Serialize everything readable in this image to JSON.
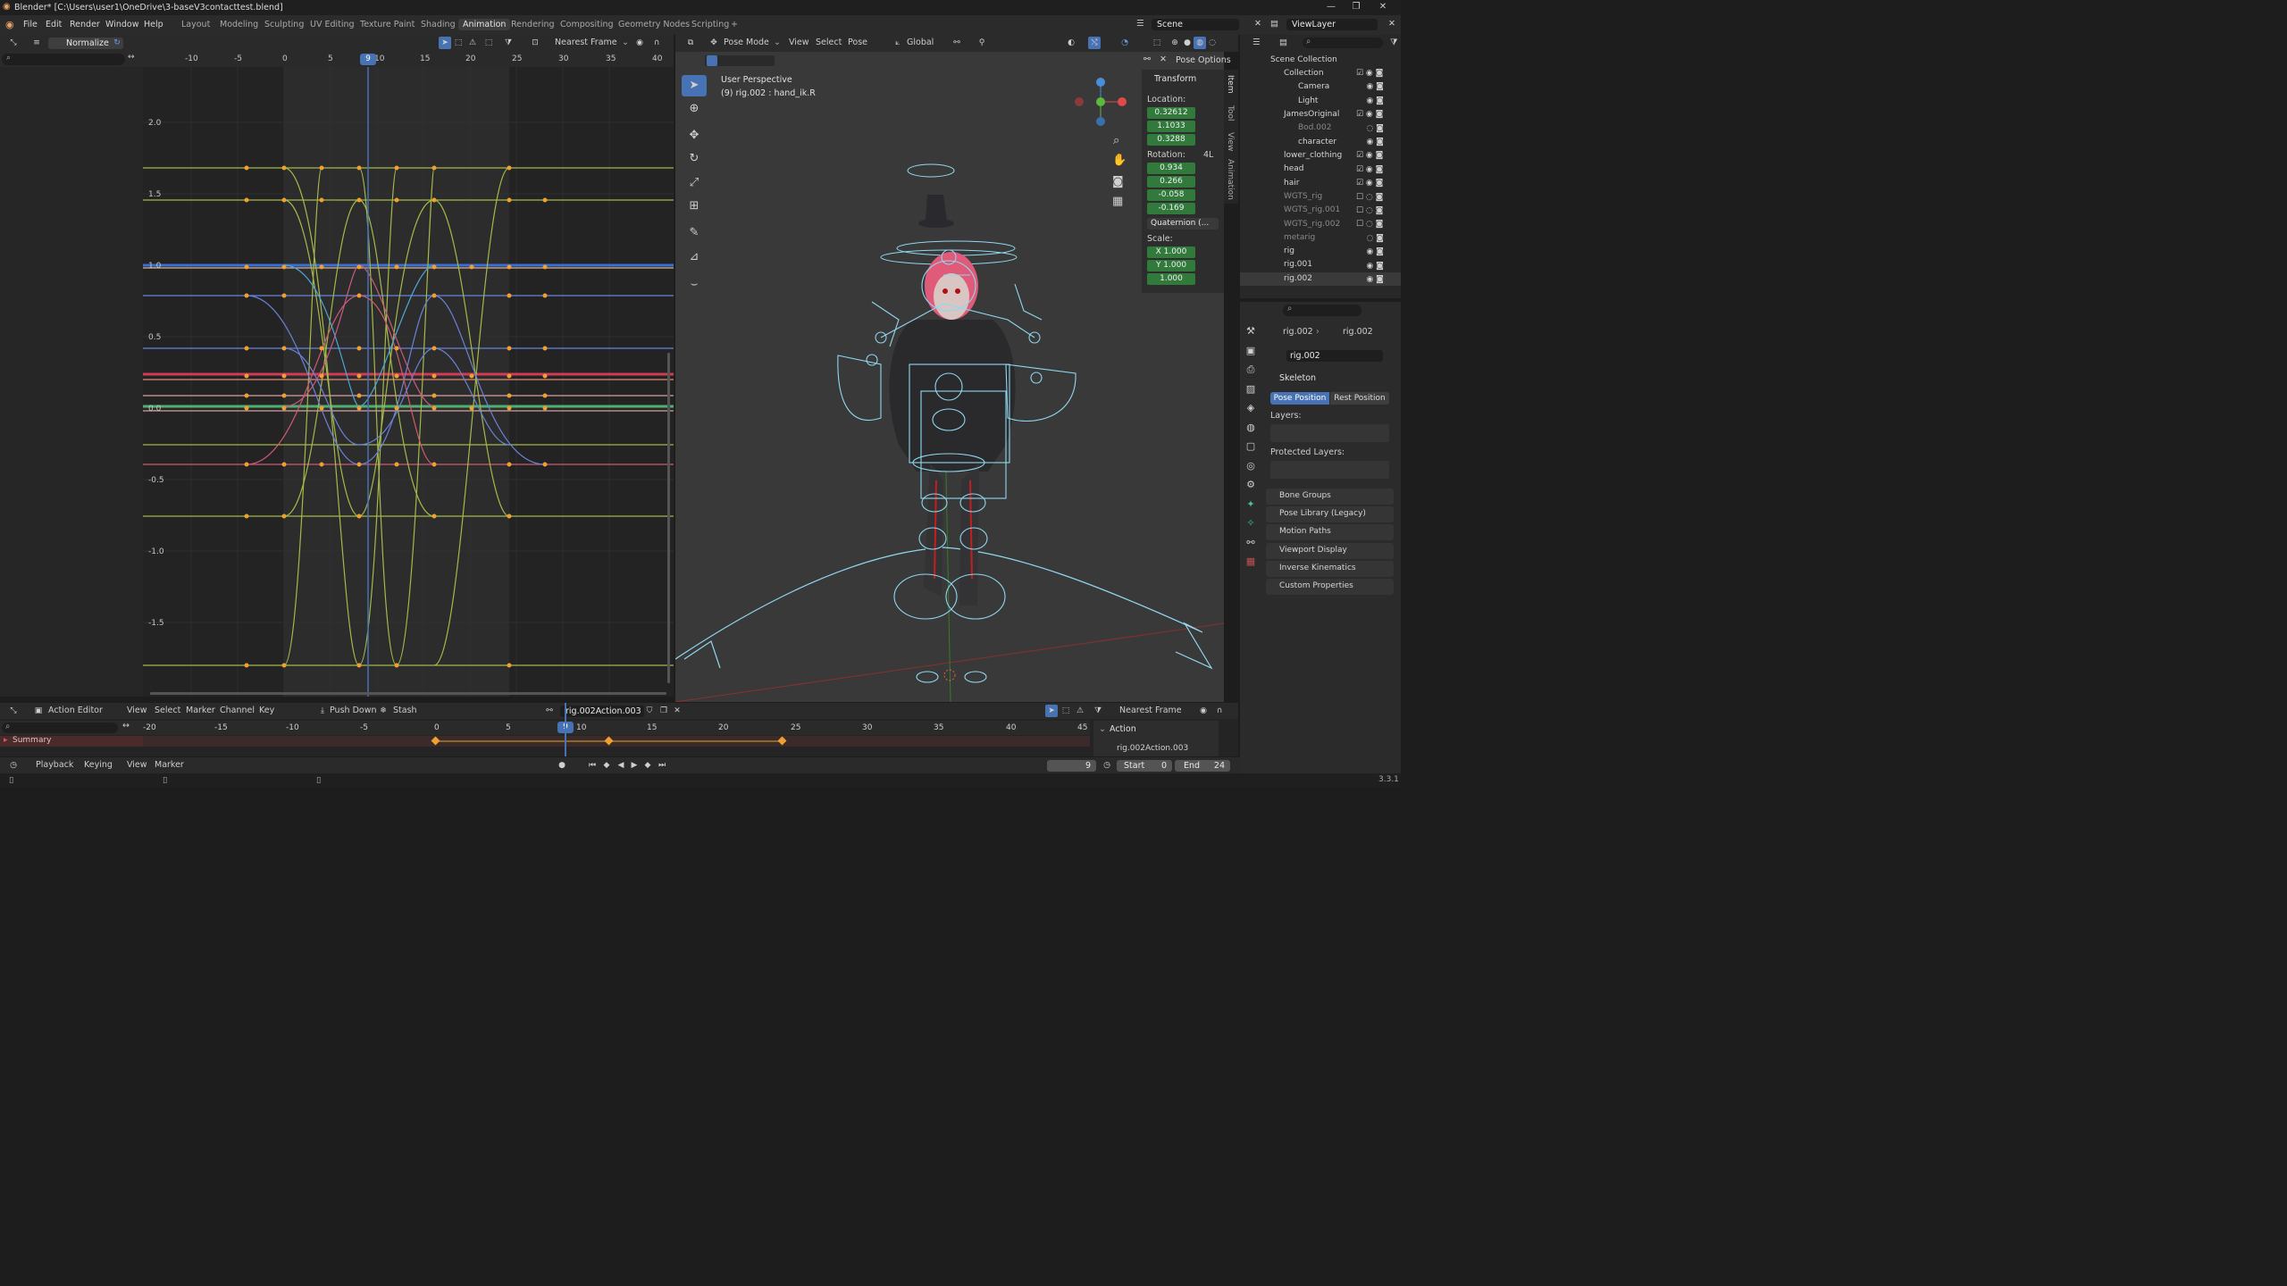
{
  "window": {
    "title": "Blender* [C:\\Users\\user1\\OneDrive\\3-baseV3contacttest.blend]"
  },
  "menu": [
    "File",
    "Edit",
    "Render",
    "Window",
    "Help"
  ],
  "workspaces": [
    "Layout",
    "Modeling",
    "Sculpting",
    "UV Editing",
    "Texture Paint",
    "Shading",
    "Animation",
    "Rendering",
    "Compositing",
    "Geometry Nodes",
    "Scripting"
  ],
  "active_workspace": "Animation",
  "scene": {
    "name": "Scene",
    "view_layer": "ViewLayer"
  },
  "graph_editor": {
    "normalize_label": "Normalize",
    "snap": "Nearest Frame",
    "current_frame": "9",
    "x_ticks": [
      "-10",
      "-5",
      "0",
      "5",
      "10",
      "15",
      "20",
      "25",
      "30",
      "35",
      "40"
    ],
    "y_ticks": [
      "2.0",
      "1.5",
      "1.0",
      "0.5",
      "0.0",
      "-0.5",
      "-1.0",
      "-1.5"
    ]
  },
  "viewport": {
    "mode": "Pose Mode",
    "menus": [
      "View",
      "Select",
      "Pose"
    ],
    "orientation": "Global",
    "perspective": "User Perspective",
    "active": "(9) rig.002 : hand_ik.R",
    "pose_options": "Pose Options"
  },
  "npanel": {
    "tabs": [
      "Item",
      "Tool",
      "View",
      "Animation"
    ],
    "section": "Transform",
    "location_label": "Location:",
    "location": [
      "0.32612",
      "1.1033",
      "0.3288"
    ],
    "rotation_label": "Rotation:",
    "rotation_mode_tag": "4L",
    "rotation": [
      "0.934",
      "0.266",
      "-0.058",
      "-0.169"
    ],
    "rotation_mode": "Quaternion (...",
    "scale_label": "Scale:",
    "scale": [
      "X  1.000",
      "Y  1.000",
      "1.000"
    ]
  },
  "outliner": {
    "title": "Scene Collection",
    "rows": [
      {
        "label": "Collection"
      },
      {
        "label": "Camera"
      },
      {
        "label": "Light"
      },
      {
        "label": "JamesOriginal"
      },
      {
        "label": "Bod.002"
      },
      {
        "label": "character"
      },
      {
        "label": "lower_clothing"
      },
      {
        "label": "head"
      },
      {
        "label": "hair"
      },
      {
        "label": "WGTS_rig"
      },
      {
        "label": "WGTS_rig.001"
      },
      {
        "label": "WGTS_rig.002"
      },
      {
        "label": "metarig"
      },
      {
        "label": "rig"
      },
      {
        "label": "rig.001"
      },
      {
        "label": "rig.002"
      }
    ]
  },
  "properties": {
    "breadcrumb": [
      "rig.002",
      "rig.002"
    ],
    "object_name": "rig.002",
    "skeleton": "Skeleton",
    "pose_position": "Pose Position",
    "rest_position": "Rest Position",
    "layers": "Layers:",
    "protected_layers": "Protected Layers:",
    "panels": [
      "Bone Groups",
      "Pose Library (Legacy)",
      "Motion Paths",
      "Viewport Display",
      "Inverse Kinematics",
      "Custom Properties"
    ]
  },
  "action_editor": {
    "mode": "Action Editor",
    "menus": [
      "View",
      "Select",
      "Marker",
      "Channel",
      "Key"
    ],
    "push_down": "Push Down",
    "stash": "Stash",
    "action_name": "rig.002Action.003",
    "snap": "Nearest Frame",
    "summary": "Summary",
    "x_ticks": [
      "-20",
      "-15",
      "-10",
      "-5",
      "0",
      "5",
      "10",
      "15",
      "20",
      "25",
      "30",
      "35",
      "40",
      "45"
    ],
    "current_frame": "9",
    "side_panel_title": "Action",
    "side_action": "rig.002Action.003"
  },
  "timeline": {
    "menus": [
      "Playback",
      "Keying",
      "View",
      "Marker"
    ],
    "frame": "9",
    "start_label": "Start",
    "start": "0",
    "end_label": "End",
    "end": "24"
  },
  "status": {
    "version": "3.3.1"
  },
  "colors": {
    "accent": "#4772b3",
    "keyframe": "#f0a030",
    "green_field": "#317a3c",
    "bone": "#8fd8f0"
  }
}
